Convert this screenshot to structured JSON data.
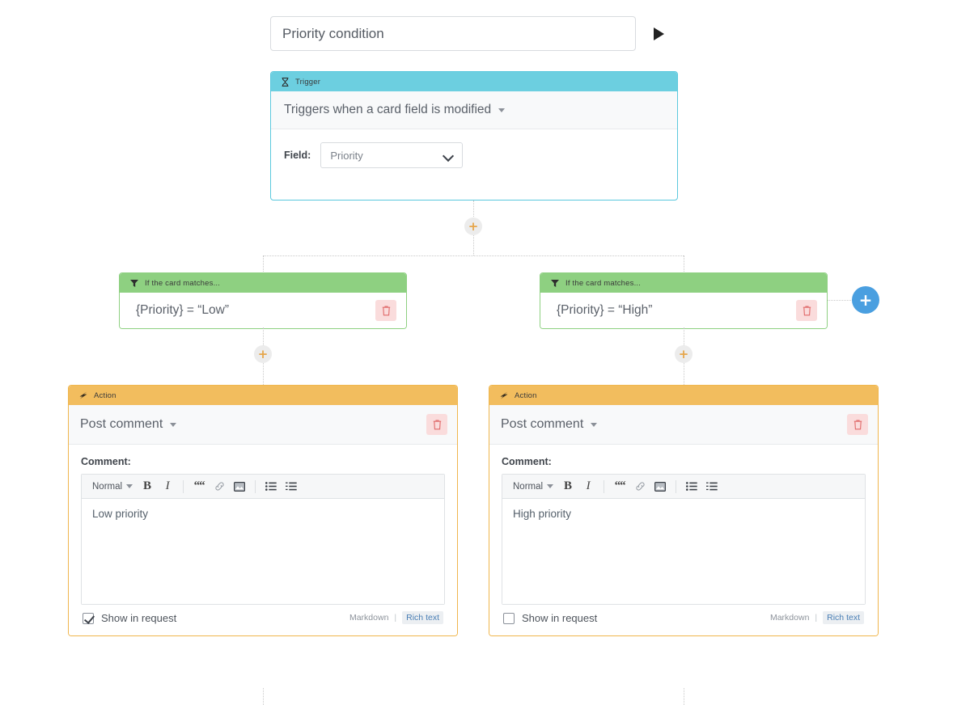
{
  "header": {
    "title_value": "Priority condition",
    "title_placeholder": "Rule name",
    "run_icon": "play-icon"
  },
  "trigger": {
    "header_label": "Trigger",
    "header_icon": "hourglass-icon",
    "event_label": "Triggers when a card field is modified",
    "field_label": "Field:",
    "field_value": "Priority",
    "accent": "#6ccfe0"
  },
  "branches": [
    {
      "condition": {
        "header_label": "If the card matches...",
        "header_icon": "filter-icon",
        "expression": "{Priority} = “Low”",
        "delete_icon": "trash-icon",
        "accent": "#8ed081"
      },
      "action": {
        "header_label": "Action",
        "header_icon": "bolt-icon",
        "type_label": "Post comment",
        "delete_icon": "trash-icon",
        "comment_label": "Comment:",
        "comment_value": "Low priority",
        "show_in_request_label": "Show in request",
        "show_in_request_checked": true,
        "format_markdown": "Markdown",
        "format_divider": "|",
        "format_rich": "Rich text",
        "accent": "#f2bd5e"
      }
    },
    {
      "condition": {
        "header_label": "If the card matches...",
        "header_icon": "filter-icon",
        "expression": "{Priority} = “High”",
        "delete_icon": "trash-icon",
        "accent": "#8ed081"
      },
      "action": {
        "header_label": "Action",
        "header_icon": "bolt-icon",
        "type_label": "Post comment",
        "delete_icon": "trash-icon",
        "comment_label": "Comment:",
        "comment_value": "High priority",
        "show_in_request_label": "Show in request",
        "show_in_request_checked": false,
        "format_markdown": "Markdown",
        "format_divider": "|",
        "format_rich": "Rich text",
        "accent": "#f2bd5e"
      }
    }
  ],
  "editor_toolbar": {
    "style_value": "Normal",
    "items": [
      {
        "name": "bold-icon",
        "glyph": "B"
      },
      {
        "name": "italic-icon",
        "glyph": "I"
      },
      {
        "name": "blockquote-icon",
        "glyph": "““"
      },
      {
        "name": "link-icon",
        "glyph": "%"
      },
      {
        "name": "image-icon",
        "glyph": "▣"
      },
      {
        "name": "bullet-list-icon",
        "glyph": "☰"
      },
      {
        "name": "ordered-list-icon",
        "glyph": "☰"
      }
    ]
  },
  "connectors": {
    "add_node_label": "+",
    "add_branch_label": "+"
  }
}
